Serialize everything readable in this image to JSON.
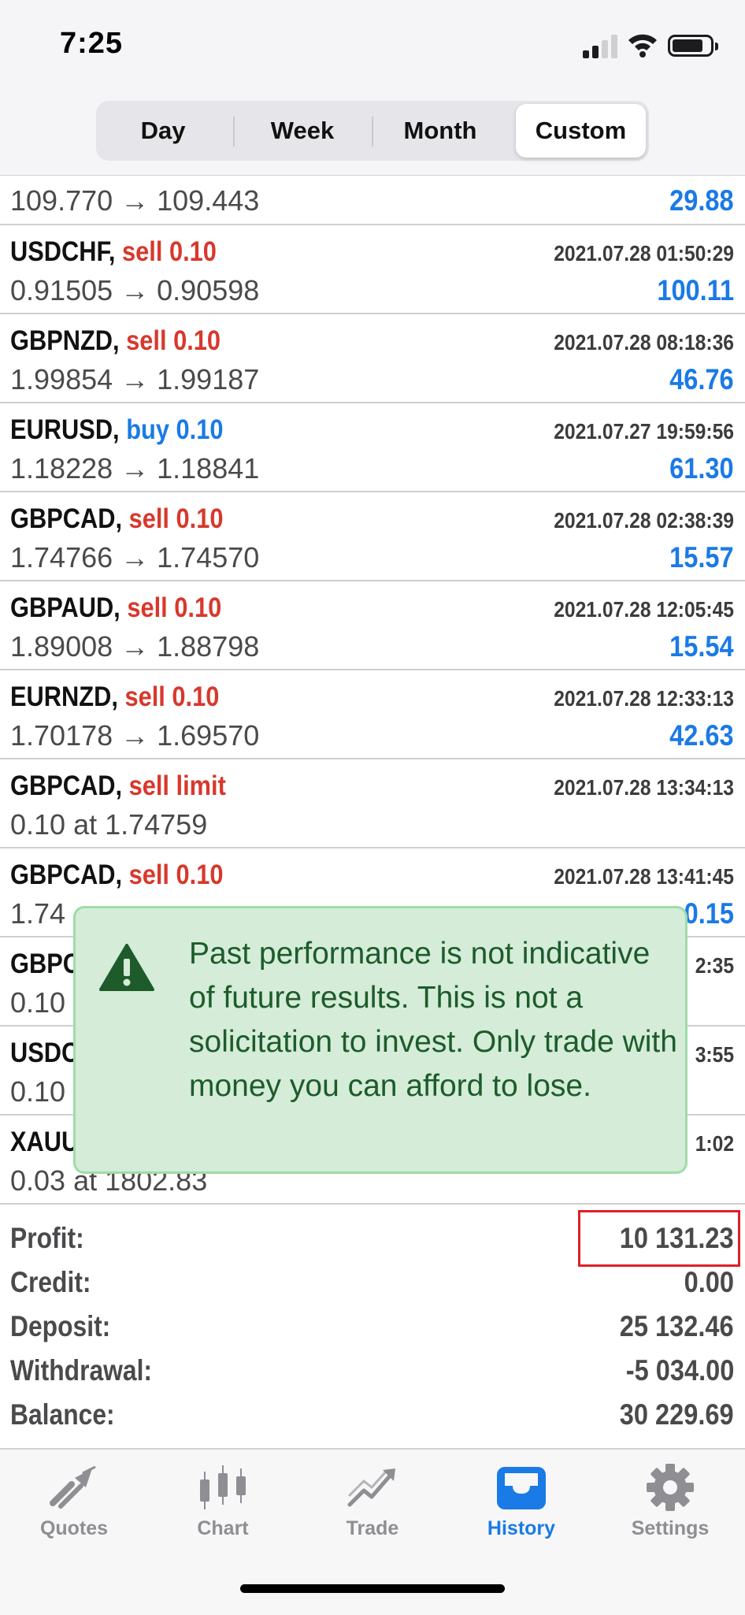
{
  "status": {
    "time": "7:25"
  },
  "segments": [
    "Day",
    "Week",
    "Month",
    "Custom"
  ],
  "segments_active": 3,
  "first_row": {
    "prices": "109.770 → 109.443",
    "pnl": "29.88"
  },
  "rows": [
    {
      "symbol": "USDCHF,",
      "action": "sell 0.10",
      "action_type": "sell",
      "timestamp": "2021.07.28 01:50:29",
      "prices": "0.91505 → 0.90598",
      "pnl": "100.11"
    },
    {
      "symbol": "GBPNZD,",
      "action": "sell 0.10",
      "action_type": "sell",
      "timestamp": "2021.07.28 08:18:36",
      "prices": "1.99854 → 1.99187",
      "pnl": "46.76"
    },
    {
      "symbol": "EURUSD,",
      "action": "buy 0.10",
      "action_type": "buy",
      "timestamp": "2021.07.27 19:59:56",
      "prices": "1.18228 → 1.18841",
      "pnl": "61.30"
    },
    {
      "symbol": "GBPCAD,",
      "action": "sell 0.10",
      "action_type": "sell",
      "timestamp": "2021.07.28 02:38:39",
      "prices": "1.74766 → 1.74570",
      "pnl": "15.57"
    },
    {
      "symbol": "GBPAUD,",
      "action": "sell 0.10",
      "action_type": "sell",
      "timestamp": "2021.07.28 12:05:45",
      "prices": "1.89008 → 1.88798",
      "pnl": "15.54"
    },
    {
      "symbol": "EURNZD,",
      "action": "sell 0.10",
      "action_type": "sell",
      "timestamp": "2021.07.28 12:33:13",
      "prices": "1.70178 → 1.69570",
      "pnl": "42.63"
    },
    {
      "symbol": "GBPCAD,",
      "action": "sell limit",
      "action_type": "sell",
      "timestamp": "2021.07.28 13:34:13",
      "prices": "0.10 at 1.74759",
      "pnl": ""
    },
    {
      "symbol": "GBPCAD,",
      "action": "sell 0.10",
      "action_type": "sell",
      "timestamp": "2021.07.28 13:41:45",
      "prices": "1.74",
      "pnl": "0.15"
    },
    {
      "symbol": "GBPC",
      "action": "",
      "action_type": "sell",
      "timestamp": "2:35",
      "prices": "0.10",
      "pnl": ""
    },
    {
      "symbol": "USDC",
      "action": "",
      "action_type": "sell",
      "timestamp": "3:55",
      "prices": "0.10",
      "pnl": ""
    },
    {
      "symbol": "XAUU",
      "action": "",
      "action_type": "sell",
      "timestamp": "1:02",
      "prices": "0.03 at 1802.83",
      "pnl": ""
    }
  ],
  "summary": [
    {
      "label": "Profit:",
      "value": "10 131.23"
    },
    {
      "label": "Credit:",
      "value": "0.00"
    },
    {
      "label": "Deposit:",
      "value": "25 132.46"
    },
    {
      "label": "Withdrawal:",
      "value": "-5 034.00"
    },
    {
      "label": "Balance:",
      "value": "30 229.69"
    }
  ],
  "toast": {
    "message": "Past performance is not indicative of future results. This is not a solicitation to invest. Only trade with money you can afford to lose.",
    "icon": "warning-icon"
  },
  "tabs": [
    {
      "label": "Quotes",
      "icon": "quotes-icon"
    },
    {
      "label": "Chart",
      "icon": "chart-icon"
    },
    {
      "label": "Trade",
      "icon": "trade-icon"
    },
    {
      "label": "History",
      "icon": "history-icon"
    },
    {
      "label": "Settings",
      "icon": "gear-icon"
    }
  ],
  "tabs_active": 3,
  "colors": {
    "sell": "#d8382c",
    "buy": "#1a7ae6",
    "accent": "#1a7ae6",
    "toast_bg": "#d4ecd8",
    "highlight": "#e01f26"
  }
}
